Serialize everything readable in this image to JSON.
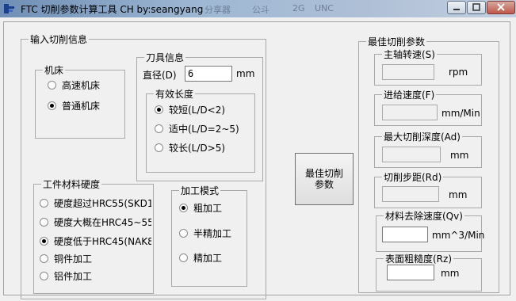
{
  "window": {
    "title": "FTC 切削参数计算工具  CH by:seangyang",
    "ghost_text": [
      "分享器",
      "公斗",
      "2G",
      "UNC"
    ]
  },
  "input_group": {
    "legend": "输入切削信息",
    "machine": {
      "legend": "机床",
      "options": [
        {
          "label": "高速机床",
          "checked": false
        },
        {
          "label": "普通机床",
          "checked": true
        }
      ]
    },
    "tool": {
      "legend": "刀具信息",
      "diameter_label": "直径(D)",
      "diameter_value": "6",
      "diameter_unit": "mm",
      "length": {
        "legend": "有效长度",
        "options": [
          {
            "label": "较短(L/D<2)",
            "checked": true
          },
          {
            "label": "适中(L/D=2~5)",
            "checked": false
          },
          {
            "label": "较长(L/D>5)",
            "checked": false
          }
        ]
      }
    },
    "hardness": {
      "legend": "工件材料硬度",
      "options": [
        {
          "label": "硬度超过HRC55(SKD1",
          "checked": false
        },
        {
          "label": "硬度大概在HRC45~55",
          "checked": false
        },
        {
          "label": "硬度低于HRC45(NAK8(",
          "checked": true
        },
        {
          "label": "铜件加工",
          "checked": false
        },
        {
          "label": "铝件加工",
          "checked": false
        }
      ]
    },
    "mode": {
      "legend": "加工模式",
      "options": [
        {
          "label": "粗加工",
          "checked": true
        },
        {
          "label": "半精加工",
          "checked": false
        },
        {
          "label": "精加工",
          "checked": false
        }
      ]
    }
  },
  "calc_button": {
    "line1": "最佳切削",
    "line2": "参数"
  },
  "output_group": {
    "legend": "最佳切削参数",
    "fields": [
      {
        "legend": "主轴转速(S)",
        "value": "",
        "unit": "rpm"
      },
      {
        "legend": "进给速度(F)",
        "value": "",
        "unit": "mm/Min"
      },
      {
        "legend": "最大切削深度(Ad)",
        "value": "",
        "unit": "mm"
      },
      {
        "legend": "切削步距(Rd)",
        "value": "",
        "unit": "mm"
      },
      {
        "legend": "材料去除速度(Qv)",
        "value": "",
        "unit": "mm^3/Min"
      },
      {
        "legend": "表面粗糙度(Rz)",
        "value": "",
        "unit": "mm"
      }
    ]
  }
}
